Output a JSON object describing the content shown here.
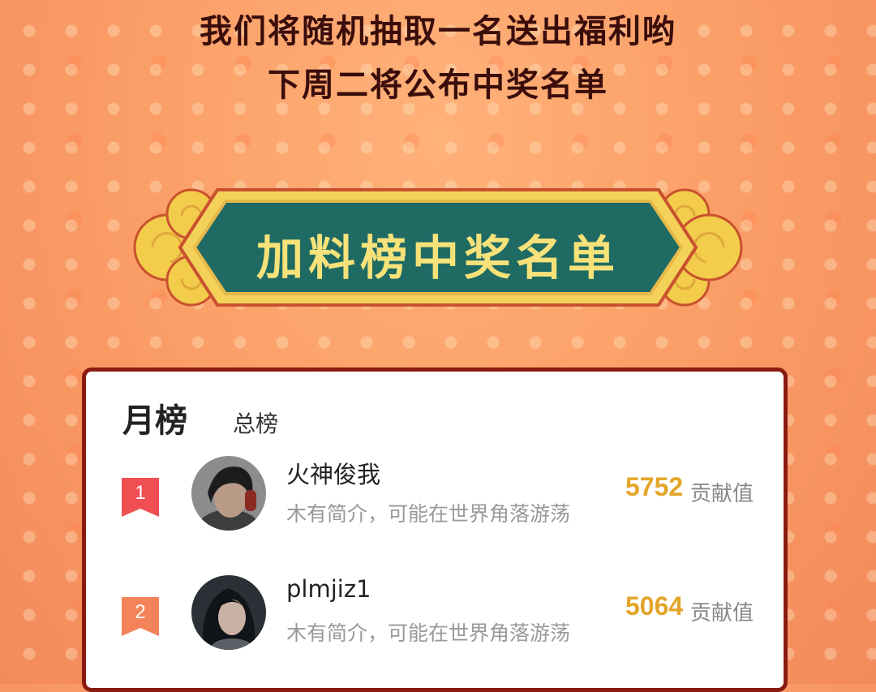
{
  "announcement": {
    "line1": "我们将随机抽取一名送出福利哟",
    "line2": "下周二将公布中奖名单"
  },
  "banner": {
    "title": "加料榜中奖名单"
  },
  "leaderboard": {
    "tabs": [
      {
        "label": "月榜",
        "active": true
      },
      {
        "label": "总榜",
        "active": false
      }
    ],
    "entries": [
      {
        "rank": "1",
        "name": "火神俊我",
        "bio": "木有简介，可能在世界角落游荡",
        "score": "5752",
        "score_unit": "贡献值"
      },
      {
        "rank": "2",
        "name": "plmjiz1",
        "bio": "木有简介，可能在世界角落游荡",
        "score": "5064",
        "score_unit": "贡献值"
      }
    ]
  },
  "colors": {
    "banner_fill": "#1f6b63",
    "banner_gold": "#f2cc4a",
    "card_border": "#8a1b10",
    "score": "#e3a529",
    "rank_1": "#ef4f53",
    "rank_2": "#f5835a"
  },
  "icons": [
    "rank-ribbon-icon",
    "cloud-ornament-icon"
  ]
}
